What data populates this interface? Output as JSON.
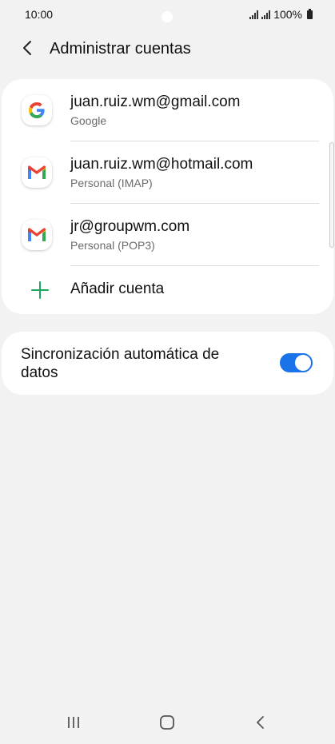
{
  "status_bar": {
    "time": "10:00",
    "battery": "100%"
  },
  "header": {
    "title": "Administrar cuentas"
  },
  "accounts": [
    {
      "email": "juan.ruiz.wm@gmail.com",
      "type": "Google",
      "icon": "google-icon"
    },
    {
      "email": "juan.ruiz.wm@hotmail.com",
      "type": "Personal (IMAP)",
      "icon": "gmail-icon"
    },
    {
      "email": "jr@groupwm.com",
      "type": "Personal (POP3)",
      "icon": "gmail-icon"
    }
  ],
  "add_account": {
    "label": "Añadir cuenta",
    "icon": "plus-icon"
  },
  "sync": {
    "label": "Sincronización automática de datos",
    "enabled": true
  },
  "colors": {
    "accent": "#1a73e8",
    "add_icon": "#1aa85f",
    "background": "#f2f2f2",
    "card": "#ffffff"
  }
}
